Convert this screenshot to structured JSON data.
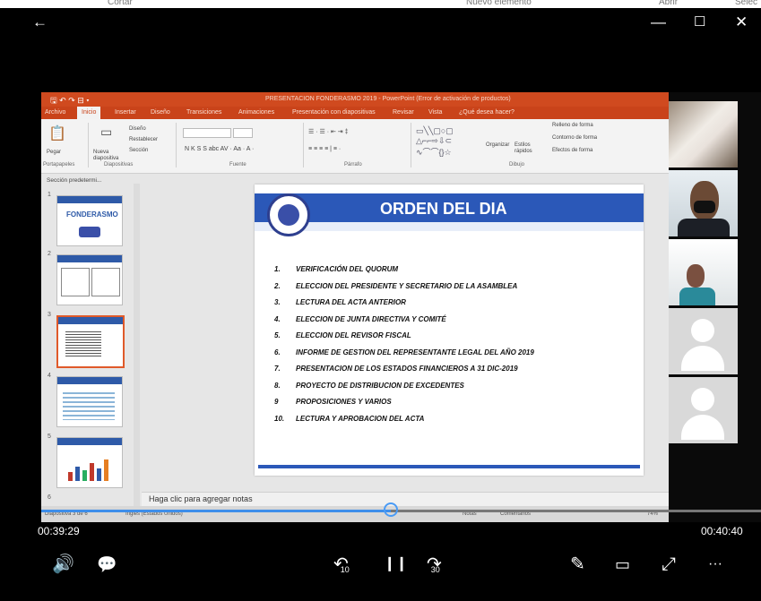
{
  "background_app": {
    "items": [
      "Cortar",
      "Nuevo elemento",
      "Abrir",
      "Selec"
    ]
  },
  "player": {
    "back_icon": "arrow-left-icon",
    "window_controls": {
      "minimize": "—",
      "maximize": "☐",
      "close": "✕"
    },
    "time_current": "00:39:29",
    "time_total": "00:40:40",
    "progress_fraction": 0.971,
    "accent_color": "#3d8eea"
  },
  "ppt": {
    "window_title": "PRESENTACION FONDERASMO 2019 - PowerPoint (Error de activación de productos)",
    "tabs": [
      "Archivo",
      "Inicio",
      "Insertar",
      "Diseño",
      "Transiciones",
      "Animaciones",
      "Presentación con diapositivas",
      "Revisar",
      "Vista",
      "¿Qué desea hacer?"
    ],
    "ribbon": {
      "paste": "Pegar",
      "portapapeles": "Portapapeles",
      "nueva_diapositiva": "Nueva diapositiva",
      "diseno": "Diseño",
      "restablecer": "Restablecer",
      "seccion": "Sección",
      "diapositivas": "Diapositivas",
      "fuente": "Fuente",
      "parrafo": "Párrafo",
      "organizar": "Organizar",
      "estilos_rapidos": "Estilos rápidos",
      "relleno": "Relleno de forma",
      "contorno": "Contorno de forma",
      "efectos": "Efectos de forma",
      "dibujo": "Dibujo"
    },
    "section_label": "Sección predetermi...",
    "thumb_numbers": [
      "1",
      "2",
      "3",
      "4",
      "5",
      "6"
    ],
    "thumb1_text": "FONDERASMO",
    "notes_placeholder": "Haga clic para agregar notas",
    "status_left": "Diapositiva 3 de 6",
    "status_lang": "Inglés (Estados Unidos)",
    "status_notes": "Notas",
    "status_comments": "Comentarios",
    "zoom": "74%"
  },
  "slide": {
    "title": "ORDEN DEL DIA",
    "items": [
      {
        "n": "1.",
        "text": "VERIFICACIÓN DEL QUORUM"
      },
      {
        "n": "2.",
        "text": "ELECCION DEL PRESIDENTE Y SECRETARIO DE LA ASAMBLEA"
      },
      {
        "n": "3.",
        "text": "LECTURA DEL ACTA ANTERIOR"
      },
      {
        "n": "4.",
        "text": "ELECCION DE  JUNTA DIRECTIVA Y COMITÉ"
      },
      {
        "n": "5.",
        "text": "ELECCION DEL REVISOR FISCAL"
      },
      {
        "n": "6.",
        "text": "INFORME DE GESTION DEL REPRESENTANTE LEGAL DEL AÑO 2019"
      },
      {
        "n": "7.",
        "text": "PRESENTACION DE LOS ESTADOS FINANCIEROS A 31 DIC-2019"
      },
      {
        "n": "8.",
        "text": "PROYECTO DE DISTRIBUCION DE EXCEDENTES"
      },
      {
        "n": "9",
        "text": "PROPOSICIONES Y VARIOS"
      },
      {
        "n": "10.",
        "text": "LECTURA Y APROBACION DEL ACTA"
      }
    ]
  },
  "controls": {
    "volume_icon": "🔊",
    "captions_icon": "💬",
    "rewind_label": "10",
    "pause_icon": "❙❙",
    "forward_label": "30",
    "pen_icon": "✎",
    "cast_icon": "▭",
    "fullscreen_icon": "⤢",
    "more_icon": "···"
  }
}
